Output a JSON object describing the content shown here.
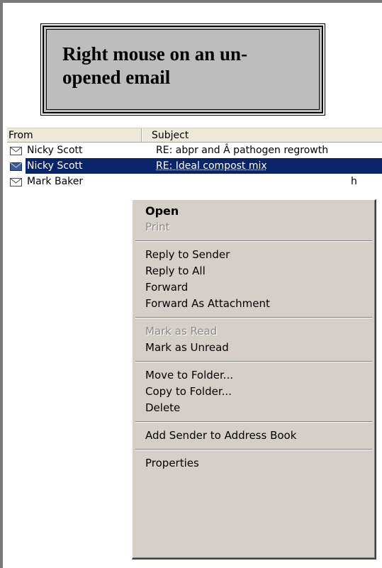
{
  "callout": {
    "text": "Right mouse on an un-opened email"
  },
  "columns": {
    "from": "From",
    "subject": "Subject"
  },
  "emails": [
    {
      "from": "Nicky Scott",
      "subject": "RE: abpr and Â pathogen regrowth",
      "selected": false
    },
    {
      "from": "Nicky Scott",
      "subject": "RE: Ideal compost mix",
      "selected": true
    },
    {
      "from": "Mark Baker",
      "subject": "h",
      "selected": false
    }
  ],
  "menu": {
    "open": "Open",
    "print": "Print",
    "reply_to_sender": "Reply to Sender",
    "reply_to_all": "Reply to All",
    "forward": "Forward",
    "forward_as_attachment": "Forward As Attachment",
    "mark_as_read": "Mark as Read",
    "mark_as_unread": "Mark as Unread",
    "move_to_folder": "Move to Folder...",
    "copy_to_folder": "Copy to Folder...",
    "delete": "Delete",
    "add_sender": "Add Sender to Address Book",
    "properties": "Properties"
  },
  "colors": {
    "selection": "#0a246a",
    "menu_bg": "#d4d0c8",
    "callout_bg": "#bdbdbd"
  },
  "icons": {
    "email_row": "closed-envelope-icon"
  }
}
